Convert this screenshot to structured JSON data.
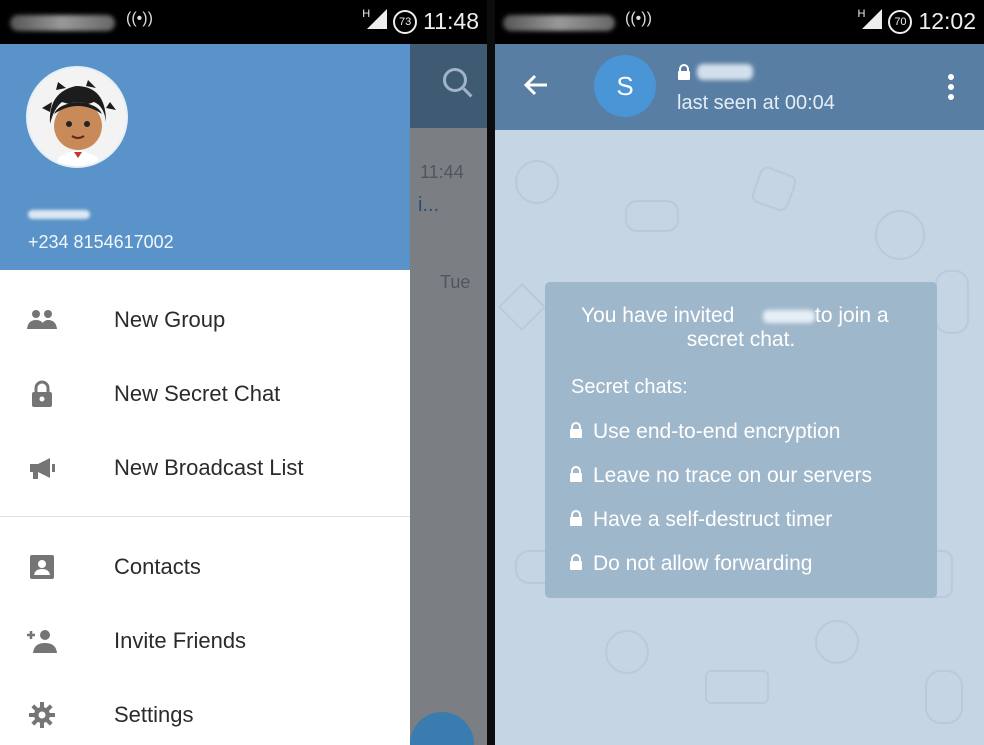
{
  "left_status": {
    "time": "11:48",
    "battery": "73",
    "network_type": "H"
  },
  "right_status": {
    "time": "12:02",
    "battery": "70",
    "network_type": "H"
  },
  "background_list": {
    "time_1": "11:44",
    "snippet_1": "i...",
    "time_2": "Tue"
  },
  "drawer": {
    "phone_number": "+234 8154617002",
    "menu": [
      {
        "label": "New Group",
        "icon": "group-icon"
      },
      {
        "label": "New Secret Chat",
        "icon": "lock-icon"
      },
      {
        "label": "New Broadcast List",
        "icon": "megaphone-icon"
      },
      {
        "label": "Contacts",
        "icon": "contact-card-icon"
      },
      {
        "label": "Invite Friends",
        "icon": "add-person-icon"
      },
      {
        "label": "Settings",
        "icon": "gear-icon"
      }
    ]
  },
  "chat": {
    "avatar_letter": "S",
    "last_seen": "last seen at 00:04",
    "invite_pre": "You have invited",
    "invite_post": "to join a",
    "invite_line2": "secret chat.",
    "secret_title": "Secret chats:",
    "features": [
      "Use end-to-end encryption",
      "Leave no trace on our servers",
      "Have a self-destruct timer",
      "Do not allow forwarding"
    ]
  },
  "colors": {
    "drawer_header": "#5a93c9",
    "chat_topbar": "#587ea3",
    "chat_background": "#c5d5e3",
    "secret_card": "#9fb7cb"
  }
}
